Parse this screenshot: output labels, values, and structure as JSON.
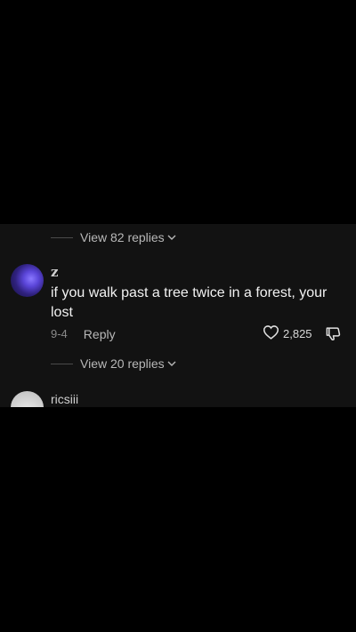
{
  "comments_panel": {
    "view_replies_top": {
      "label": "View 82 replies",
      "icon": "chevron-down-icon"
    },
    "comment": {
      "username": "z",
      "text": "if you walk past a tree twice in a forest, your lost",
      "date": "9-4",
      "reply_label": "Reply",
      "likes": "2,825",
      "like_icon": "heart-icon",
      "dislike_icon": "thumbs-down-icon"
    },
    "view_replies_comment": {
      "label": "View 20 replies",
      "icon": "chevron-down-icon"
    },
    "next_comment": {
      "username": "ricsiii"
    }
  },
  "colors": {
    "background": "#000000",
    "panel": "#121212",
    "avatar_z": "#5a45d8"
  }
}
